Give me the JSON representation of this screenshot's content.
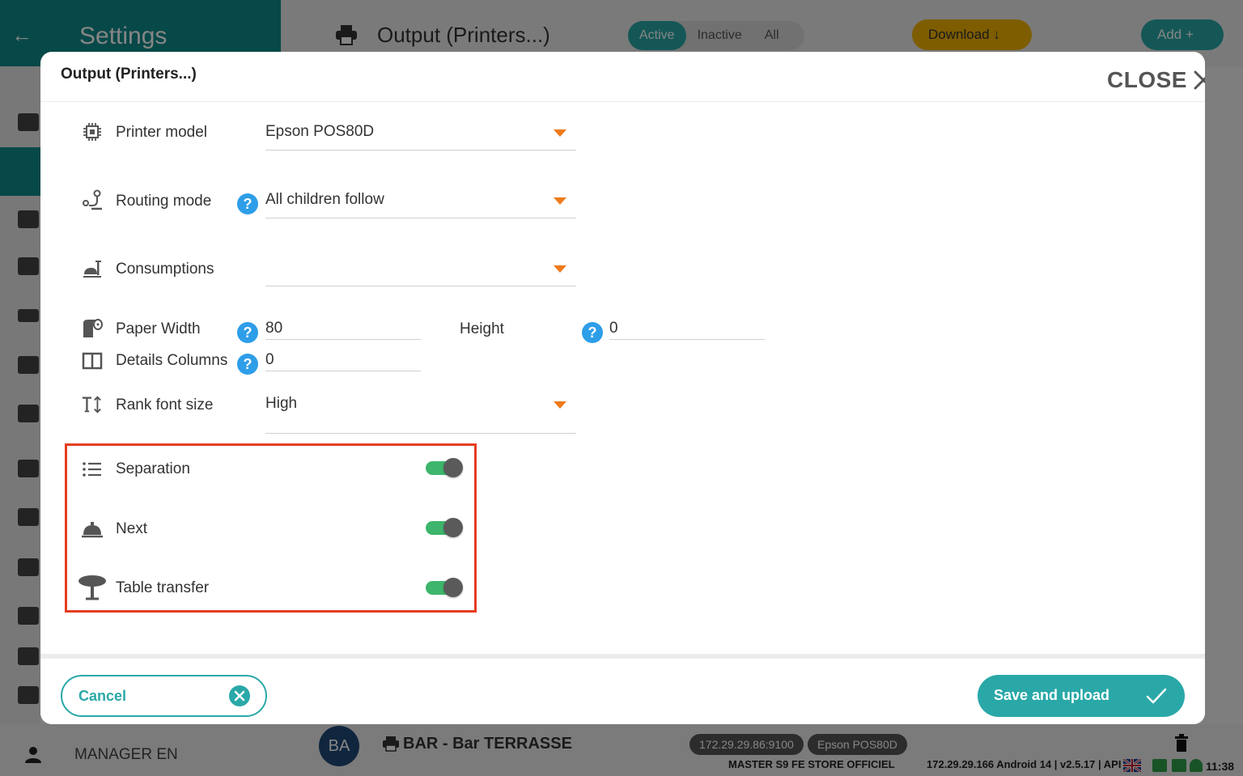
{
  "background": {
    "settings_title": "Settings",
    "page_title": "Output (Printers...)",
    "filters": [
      "Active",
      "Inactive",
      "All"
    ],
    "download_label": "Download",
    "add_label": "Add",
    "user_label": "MANAGER EN",
    "printer_row": {
      "avatar": "BA",
      "name": "BAR  - Bar TERRASSE",
      "ip_port": "172.29.29.86:9100",
      "model": "Epson POS80D"
    },
    "status": {
      "store": "MASTER S9 FE STORE OFFICIEL",
      "info": "172.29.29.166  Android 14  |  v2.5.17 | API v8",
      "time": "11:38"
    }
  },
  "modal": {
    "title": "Output (Printers...)",
    "close_label": "CLOSE",
    "printer_model": {
      "label": "Printer model",
      "value": "Epson POS80D"
    },
    "routing_mode": {
      "label": "Routing mode",
      "value": "All children follow"
    },
    "consumptions": {
      "label": "Consumptions",
      "value": ""
    },
    "paper_width": {
      "label": "Paper Width",
      "value": "80"
    },
    "height": {
      "label": "Height",
      "value": "0"
    },
    "details_columns": {
      "label": "Details Columns",
      "value": "0"
    },
    "rank_font_size": {
      "label": "Rank font size",
      "value": "High"
    },
    "toggles": [
      {
        "label": "Separation",
        "on": true
      },
      {
        "label": "Next",
        "on": true
      },
      {
        "label": "Table transfer",
        "on": true
      }
    ],
    "cancel_label": "Cancel",
    "save_label": "Save and upload"
  },
  "colors": {
    "teal": "#2aa8a8",
    "accent_orange": "#ee7a1c",
    "help_blue": "#2e9ee8",
    "toggle_green": "#3db56c",
    "highlight_red": "#e53c1f"
  },
  "icons": {
    "printer_model": "chip-icon",
    "routing_mode": "routing-icon",
    "consumptions": "consumption-icon",
    "paper_width": "paper-roll-icon",
    "details_columns": "columns-icon",
    "rank_font_size": "font-size-icon",
    "separation": "list-icon",
    "next": "service-bell-icon",
    "table_transfer": "table-icon",
    "close": "close-icon"
  }
}
